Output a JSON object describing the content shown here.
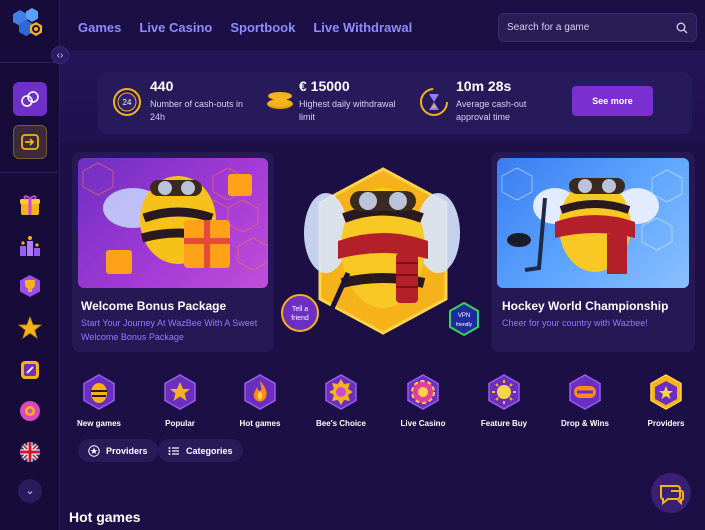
{
  "nav": {
    "items": [
      "Games",
      "Live Casino",
      "Sportbook",
      "Live Withdrawal"
    ],
    "search_placeholder": "Search for a game"
  },
  "stats": {
    "cashouts": {
      "value": "440",
      "label_line1": "Number of cash-outs in",
      "label_line2": "24h",
      "badge": "24"
    },
    "withdrawal": {
      "value": "€ 15000",
      "label_line1": "Highest daily withdrawal",
      "label_line2": "limit"
    },
    "approval": {
      "value": "10m 28s",
      "label_line1": "Average cash-out",
      "label_line2": "approval time"
    },
    "see_more": "See more"
  },
  "promos": {
    "welcome": {
      "title": "Welcome Bonus Package",
      "subtitle_line1": "Start Your Journey At WazBee With A Sweet",
      "subtitle_line2": "Welcome Bonus Package"
    },
    "center": {
      "bubble_left_1": "Tell a",
      "bubble_left_2": "friend",
      "bubble_right_1": "VPN",
      "bubble_right_2": "friendly"
    },
    "hockey": {
      "title": "Hockey World Championship",
      "subtitle": "Cheer for your country with Wazbee!"
    }
  },
  "categories": [
    {
      "label": "New games",
      "icon": "bee-new-icon"
    },
    {
      "label": "Popular",
      "icon": "star-icon"
    },
    {
      "label": "Hot games",
      "icon": "flame-icon"
    },
    {
      "label": "Bee's Choice",
      "icon": "badge-icon"
    },
    {
      "label": "Live Casino",
      "icon": "chip-icon"
    },
    {
      "label": "Feature Buy",
      "icon": "sun-icon"
    },
    {
      "label": "Drop & Wins",
      "icon": "dew-icon"
    },
    {
      "label": "Providers",
      "icon": "hex-star-icon"
    }
  ],
  "filters": {
    "providers": "Providers",
    "categories": "Categories"
  },
  "section": {
    "hot_games": "Hot games"
  },
  "colors": {
    "background": "#1c0f45",
    "accent": "#7a2fd0",
    "nav_link": "#8d8dff",
    "subtitle": "#8e7dff",
    "gold": "#f6b21a"
  }
}
